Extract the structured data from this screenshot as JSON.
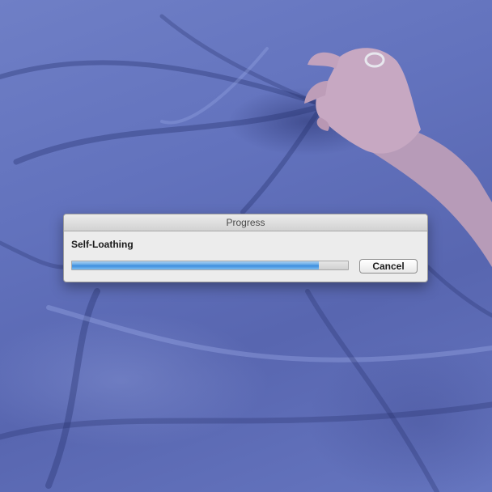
{
  "dialog": {
    "title": "Progress",
    "task_label": "Self-Loathing",
    "progress_fraction": 0.895,
    "cancel_label": "Cancel"
  },
  "colors": {
    "background": "#6272bd",
    "dialog_body": "#ececec",
    "progress_fill": "#3d8ede"
  },
  "background_image": "blue bed sheet with a hand gripping the fabric"
}
